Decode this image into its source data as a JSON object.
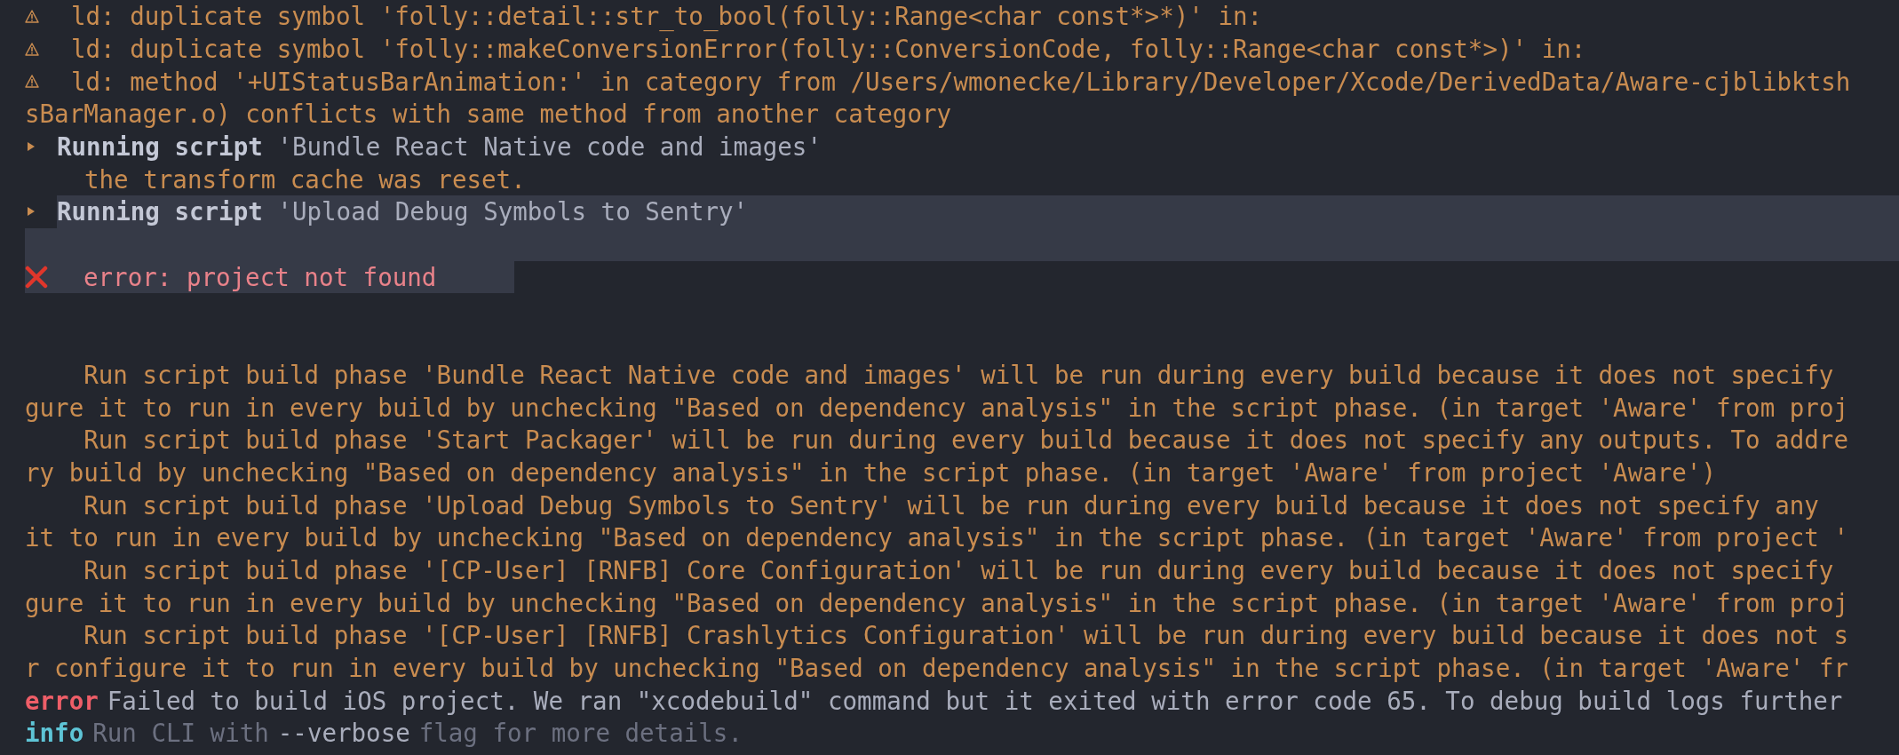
{
  "lines": [
    {
      "kind": "warning",
      "text": "ld: duplicate symbol 'folly::detail::str_to_bool(folly::Range<char const*>*)' in:"
    },
    {
      "kind": "warning",
      "text": "ld: duplicate symbol 'folly::makeConversionError(folly::ConversionCode, folly::Range<char const*>)' in:"
    },
    {
      "kind": "warning",
      "text": "ld: method '+UIStatusBarAnimation:' in category from /Users/wmonecke/Library/Developer/Xcode/DerivedData/Aware-cjblibktsh"
    },
    {
      "kind": "plain",
      "indent": false,
      "text": "sBarManager.o) conflicts with same method from another category"
    },
    {
      "kind": "script",
      "highlighted": false,
      "text": "**Running script** 'Bundle React Native code and images'"
    },
    {
      "kind": "note",
      "text": "the transform cache was reset."
    },
    {
      "kind": "script",
      "highlighted": true,
      "text": "**Running script** 'Upload Debug Symbols to Sentry'"
    },
    {
      "kind": "blank",
      "highlighted": true
    },
    {
      "kind": "error",
      "highlighted": true,
      "text": "error: project not found"
    },
    {
      "kind": "blank",
      "highlighted": false
    },
    {
      "kind": "blank",
      "highlighted": false
    },
    {
      "kind": "plain",
      "indent": true,
      "text": "Run script build phase 'Bundle React Native code and images' will be run during every build because it does not specify"
    },
    {
      "kind": "plain",
      "indent": false,
      "text": "gure it to run in every build by unchecking \"Based on dependency analysis\" in the script phase. (in target 'Aware' from proj"
    },
    {
      "kind": "plain",
      "indent": true,
      "text": "Run script build phase 'Start Packager' will be run during every build because it does not specify any outputs. To addre"
    },
    {
      "kind": "plain",
      "indent": false,
      "text": "ry build by unchecking \"Based on dependency analysis\" in the script phase. (in target 'Aware' from project 'Aware')"
    },
    {
      "kind": "plain",
      "indent": true,
      "text": "Run script build phase 'Upload Debug Symbols to Sentry' will be run during every build because it does not specify any"
    },
    {
      "kind": "plain",
      "indent": false,
      "text": "it to run in every build by unchecking \"Based on dependency analysis\" in the script phase. (in target 'Aware' from project '"
    },
    {
      "kind": "plain",
      "indent": true,
      "text": "Run script build phase '[CP-User] [RNFB] Core Configuration' will be run during every build because it does not specify"
    },
    {
      "kind": "plain",
      "indent": false,
      "text": "gure it to run in every build by unchecking \"Based on dependency analysis\" in the script phase. (in target 'Aware' from proj"
    },
    {
      "kind": "plain",
      "indent": true,
      "text": "Run script build phase '[CP-User] [RNFB] Crashlytics Configuration' will be run during every build because it does not s"
    },
    {
      "kind": "plain",
      "indent": false,
      "text": "r configure it to run in every build by unchecking \"Based on dependency analysis\" in the script phase. (in target 'Aware' fr"
    },
    {
      "kind": "error-tag",
      "tag": "error",
      "segments": [
        {
          "text": "Failed to build iOS project. We ran \"xcodebuild\" command but it exited with error code 65. To debug build logs further",
          "dim": false
        }
      ]
    },
    {
      "kind": "info-tag",
      "tag": "info",
      "segments": [
        {
          "text": "Run CLI with",
          "dim": true
        },
        {
          "text": "--verbose",
          "dim": false
        },
        {
          "text": "flag for more details.",
          "dim": true
        }
      ]
    }
  ]
}
